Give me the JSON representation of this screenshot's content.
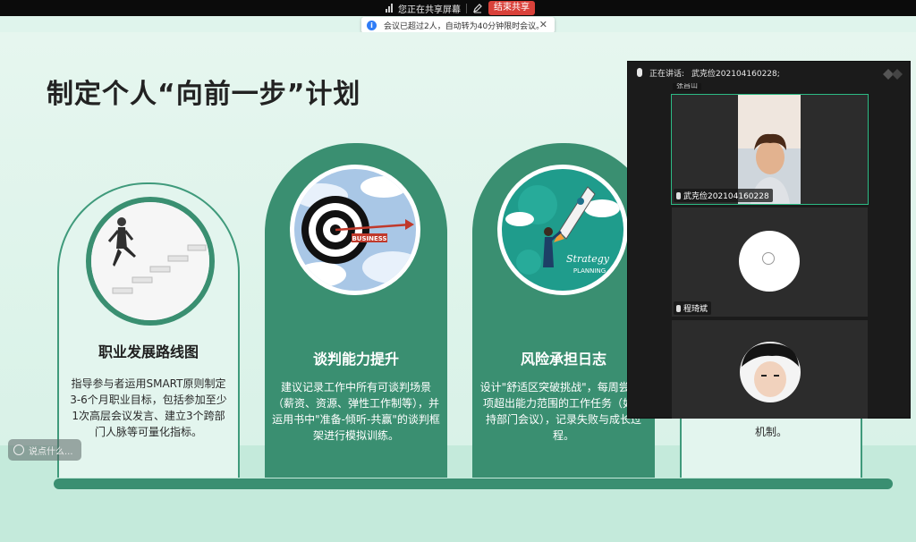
{
  "share_bar": {
    "sharing_label": "您正在共享屏幕",
    "end_share_label": "结束共享"
  },
  "toast": {
    "message": "会议已超过2人，自动转为40分钟限时会议。"
  },
  "slide": {
    "title": "制定个人“向前一步”计划",
    "cards": [
      {
        "title": "职业发展路线图",
        "body": "指导参与者运用SMART原则制定3-6个月职业目标，包括参加至少1次高层会议发言、建立3个跨部门人脉等可量化指标。"
      },
      {
        "title": "谈判能力提升",
        "body": "建议记录工作中所有可谈判场景（薪资、资源、弹性工作制等），并运用书中\"准备-倾听-共赢\"的谈判框架进行模拟训练。",
        "image_label": "BUSINESS"
      },
      {
        "title": "风险承担日志",
        "body": "设计\"舒适区突破挑战\"，每周尝试1项超出能力范围的工作任务（如主持部门会议），记录失败与成长过程。",
        "image_label_line1": "Strategy",
        "image_label_line2": "PLANNING"
      },
      {
        "body_visible": "机制。"
      }
    ]
  },
  "chat": {
    "placeholder": "说点什么..."
  },
  "video_panel": {
    "speaking_label": "正在讲话:",
    "speaking_name": "武克俭202104160228;",
    "top_partial_name": "张昌山",
    "participants": [
      {
        "name": "武克俭202104160228",
        "active": true
      },
      {
        "name": "程琦斌",
        "active": false
      },
      {
        "name": "",
        "active": false
      }
    ]
  },
  "colors": {
    "accent_green": "#3a8f71",
    "light_card": "#e3f5ee",
    "end_share_red": "#d9413a"
  }
}
